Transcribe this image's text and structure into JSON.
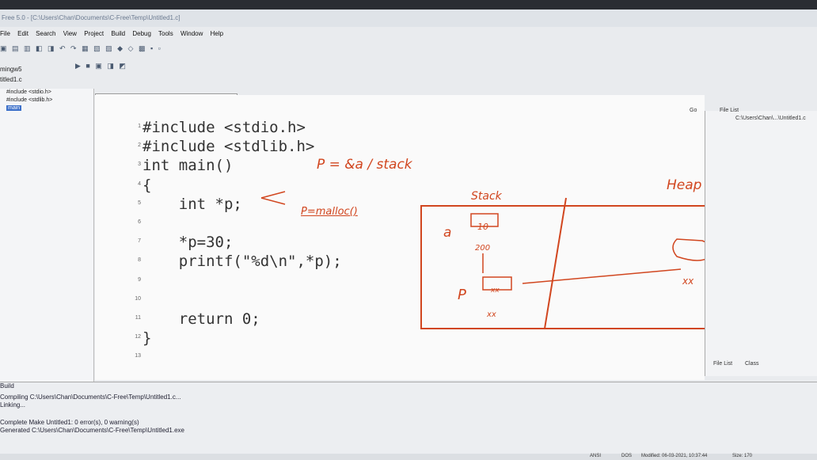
{
  "window": {
    "title": "Free 5.0 - [C:\\Users\\Chan\\Documents\\C-Free\\Temp\\Untitled1.c]"
  },
  "menu": [
    "File",
    "Edit",
    "Search",
    "View",
    "Project",
    "Build",
    "Debug",
    "Tools",
    "Window",
    "Help"
  ],
  "project": {
    "name": "mingw5",
    "file_tab": "titled1.c"
  },
  "sidebar": {
    "items": [
      {
        "label": "#include <stdio.h>"
      },
      {
        "label": "#include <stdlib.h>"
      },
      {
        "label": "main"
      }
    ]
  },
  "editor": {
    "function_box": "main",
    "lines": [
      {
        "num": "1",
        "code": "#include <stdio.h>"
      },
      {
        "num": "2",
        "code": "#include <stdlib.h>"
      },
      {
        "num": "3",
        "code": "int main()"
      },
      {
        "num": "4",
        "code": "{"
      },
      {
        "num": "5",
        "code": "    int *p;"
      },
      {
        "num": "6",
        "code": ""
      },
      {
        "num": "7",
        "code": "    *p=30;"
      },
      {
        "num": "8",
        "code": "    printf(\"%d\\n\",*p);"
      },
      {
        "num": "9",
        "code": ""
      },
      {
        "num": "10",
        "code": ""
      },
      {
        "num": "11",
        "code": "    return 0;"
      },
      {
        "num": "12",
        "code": "}"
      },
      {
        "num": "13",
        "code": ""
      }
    ]
  },
  "annotations": {
    "p_addr": "P = &a / stack",
    "malloc": "P=malloc()",
    "stack": "Stack",
    "heap": "Heap",
    "a": "a",
    "a_val": "10",
    "a_addr": "200",
    "p": "P",
    "p_val": "xx",
    "p_addr_label": "xx",
    "heap_addr": "xx"
  },
  "right_panel": {
    "go": "Go",
    "file_list": "File List",
    "path": "C:\\Users\\Chan\\...\\Untitled1.c",
    "tab1": "File List",
    "tab2": "Class"
  },
  "build": {
    "title": "Build",
    "lines": [
      "Compiling C:\\Users\\Chan\\Documents\\C-Free\\Temp\\Untitled1.c...",
      "Linking...",
      "Complete Make Untitled1: 0 error(s), 0 warning(s)",
      "Generated C:\\Users\\Chan\\Documents\\C-Free\\Temp\\Untitled1.exe"
    ]
  },
  "status": {
    "encoding": "ANSI",
    "line_end": "DOS",
    "modified": "Modified: 06-03-2021, 10:37:44",
    "size": "Size: 170"
  }
}
